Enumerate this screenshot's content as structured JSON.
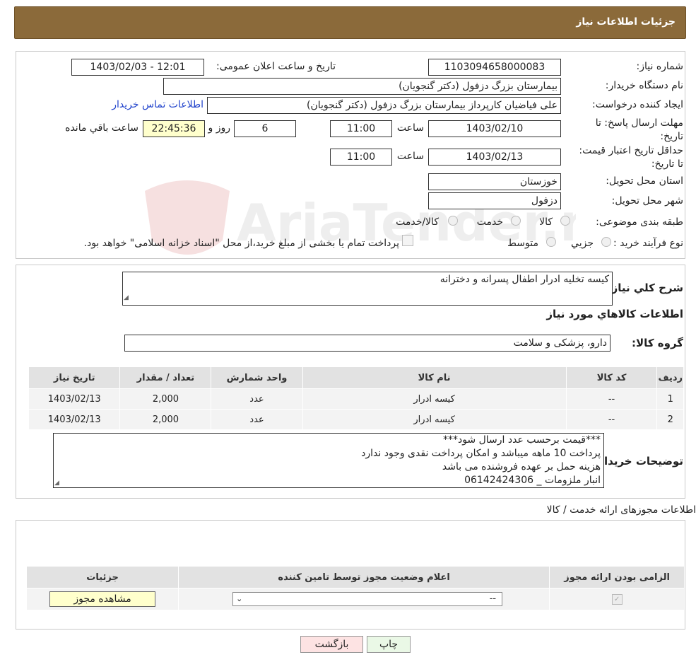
{
  "header": {
    "title": "جزئیات اطلاعات نیاز"
  },
  "watermark": {
    "text": "AriaTender.neT"
  },
  "form": {
    "need_number_label": "شماره نیاز:",
    "need_number": "1103094658000083",
    "announce_label": "تاریخ و ساعت اعلان عمومی:",
    "announce_value": "1403/02/03 - 12:01",
    "buyer_org_label": "نام دستگاه خریدار:",
    "buyer_org": "بیمارستان بزرگ دزفول (دکتر گنجویان)",
    "requester_label": "ایجاد کننده درخواست:",
    "requester": "علی فیاضیان کارپرداز بیمارستان بزرگ دزفول (دکتر گنجویان)",
    "contact_link": "اطلاعات تماس خریدار",
    "reply_deadline_label": "مهلت ارسال پاسخ: تا تاریخ:",
    "reply_date": "1403/02/10",
    "time_label": "ساعت",
    "reply_time": "11:00",
    "days": "6",
    "days_label": "روز و",
    "remaining_time": "22:45:36",
    "remaining_label": "ساعت باقي مانده",
    "price_validity_label": "حداقل تاریخ اعتبار قیمت: تا تاریخ:",
    "validity_date": "1403/02/13",
    "validity_time": "11:00",
    "province_label": "استان محل تحویل:",
    "province": "خوزستان",
    "city_label": "شهر محل تحویل:",
    "city": "دزفول",
    "category_label": "طبقه بندی موضوعی:",
    "category_options": [
      "کالا",
      "خدمت",
      "کالا/خدمت"
    ],
    "purchase_type_label": "نوع فرآیند خرید :",
    "purchase_options": [
      "جزیي",
      "متوسط"
    ],
    "purchase_note": "پرداخت تمام یا بخشی از مبلغ خرید،از محل \"اسناد خزانه اسلامی\" خواهد بود."
  },
  "summary": {
    "label": "شرح کلي نياز:",
    "text": "کیسه تخلیه ادرار اطفال پسرانه و دخترانه"
  },
  "goods": {
    "section_title": "اطلاعات کالاهاي مورد نياز",
    "group_label": "گروه کالا:",
    "group_value": "دارو، پزشکی و سلامت",
    "columns": [
      "رديف",
      "کد کالا",
      "نام کالا",
      "واحد شمارش",
      "تعداد / مقدار",
      "تاريخ نياز"
    ],
    "rows": [
      [
        "1",
        "--",
        "کیسه ادرار",
        "عدد",
        "2,000",
        "1403/02/13"
      ],
      [
        "2",
        "--",
        "کیسه ادرار",
        "عدد",
        "2,000",
        "1403/02/13"
      ]
    ]
  },
  "buyer_notes": {
    "label": "توضیحات خریدار:",
    "lines": [
      "***قیمت برحسب عدد ارسال شود***",
      "پرداخت 10 ماهه میباشد و امکان پرداخت نقدی وجود ندارد",
      "هزینه حمل بر عهده فروشنده می باشد",
      "انبار ملزومات _ 06142424306"
    ]
  },
  "permits": {
    "title": "اطلاعات مجوزهای ارائه خدمت / کالا",
    "columns": [
      "الزامی بودن ارائه مجوز",
      "اعلام وضعیت مجوز توسط تامین کننده",
      "جزئیات"
    ],
    "select_value": "--",
    "view_button": "مشاهده مجوز"
  },
  "footer": {
    "print_button": "چاپ",
    "back_button": "بازگشت"
  },
  "colors": {
    "header_bg": "#8b6a3a",
    "link": "#2244cc",
    "yellow": "#ffffcc",
    "back_btn": "#fde3e3",
    "print_btn": "#eaf8e6"
  }
}
